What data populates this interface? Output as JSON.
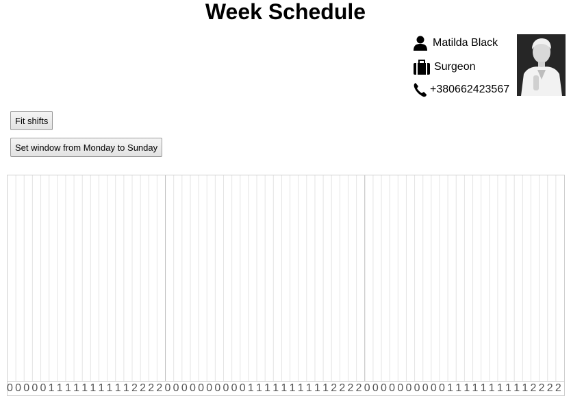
{
  "page": {
    "title": "Week Schedule"
  },
  "profile": {
    "name": "Matilda Black",
    "role": "Surgeon",
    "phone": "+380662423567",
    "name_icon": "user-icon",
    "role_icon": "briefcase-icon",
    "phone_icon": "phone-icon",
    "photo": "profile-photo"
  },
  "actions": {
    "fit_label": "Fit shifts",
    "window_label": "Set window from Monday to Sunday"
  },
  "timeline": {
    "hour_labels": [
      "0",
      "0",
      "0",
      "0",
      "0",
      "1",
      "1",
      "1",
      "1",
      "1",
      "1",
      "1",
      "1",
      "1",
      "1",
      "2",
      "2",
      "2",
      "2",
      "0",
      "0",
      "0",
      "0",
      "0",
      "0",
      "0",
      "0",
      "0",
      "0",
      "1",
      "1",
      "1",
      "1",
      "1",
      "1",
      "1",
      "1",
      "1",
      "1",
      "2",
      "2",
      "2",
      "2",
      "0",
      "0",
      "0",
      "0",
      "0",
      "0",
      "0",
      "0",
      "0",
      "0",
      "1",
      "1",
      "1",
      "1",
      "1",
      "1",
      "1",
      "1",
      "1",
      "1",
      "2",
      "2",
      "2",
      "2"
    ]
  }
}
